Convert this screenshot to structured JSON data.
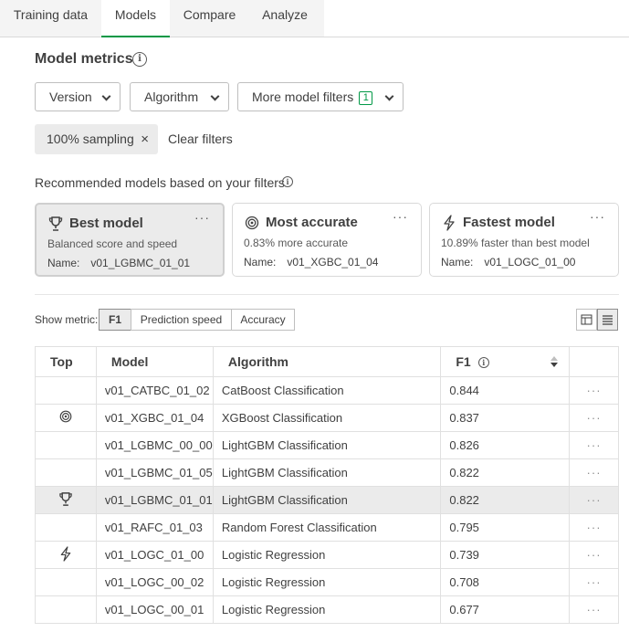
{
  "tabs": [
    "Training data",
    "Models",
    "Compare",
    "Analyze"
  ],
  "title": "Model metrics",
  "filters": {
    "version": "Version",
    "algorithm": "Algorithm",
    "more": "More model filters",
    "more_count": "1"
  },
  "chip": {
    "label": "100% sampling",
    "close": "×"
  },
  "clear_filters": "Clear filters",
  "recommended": "Recommended models based on your filters",
  "cards": [
    {
      "title": "Best model",
      "subtitle": "Balanced score and speed",
      "name_label": "Name:",
      "name": "v01_LGBMC_01_01",
      "icon": "trophy-icon"
    },
    {
      "title": "Most accurate",
      "subtitle": "0.83% more accurate",
      "name_label": "Name:",
      "name": "v01_XGBC_01_04",
      "icon": "target-icon"
    },
    {
      "title": "Fastest model",
      "subtitle": "10.89% faster than best model",
      "name_label": "Name:",
      "name": "v01_LOGC_01_00",
      "icon": "lightning-icon"
    }
  ],
  "more_glyph": "···",
  "show_metric": "Show metric:",
  "metric_buttons": [
    "F1",
    "Prediction speed",
    "Accuracy"
  ],
  "table": {
    "headers": [
      "Top",
      "Model",
      "Algorithm",
      "F1"
    ],
    "rows": [
      {
        "top": "",
        "model": "v01_CATBC_01_02",
        "algorithm": "CatBoost Classification",
        "f1": "0.844"
      },
      {
        "top": "target",
        "model": "v01_XGBC_01_04",
        "algorithm": "XGBoost Classification",
        "f1": "0.837"
      },
      {
        "top": "",
        "model": "v01_LGBMC_00_00",
        "algorithm": "LightGBM Classification",
        "f1": "0.826"
      },
      {
        "top": "",
        "model": "v01_LGBMC_01_05",
        "algorithm": "LightGBM Classification",
        "f1": "0.822"
      },
      {
        "top": "trophy",
        "model": "v01_LGBMC_01_01",
        "algorithm": "LightGBM Classification",
        "f1": "0.822"
      },
      {
        "top": "",
        "model": "v01_RAFC_01_03",
        "algorithm": "Random Forest Classification",
        "f1": "0.795"
      },
      {
        "top": "lightning",
        "model": "v01_LOGC_01_00",
        "algorithm": "Logistic Regression",
        "f1": "0.739"
      },
      {
        "top": "",
        "model": "v01_LOGC_00_02",
        "algorithm": "Logistic Regression",
        "f1": "0.708"
      },
      {
        "top": "",
        "model": "v01_LOGC_00_01",
        "algorithm": "Logistic Regression",
        "f1": "0.677"
      }
    ]
  },
  "colors": {
    "accent": "#009845",
    "text": "#404040",
    "selected_bg": "#ebebeb"
  }
}
